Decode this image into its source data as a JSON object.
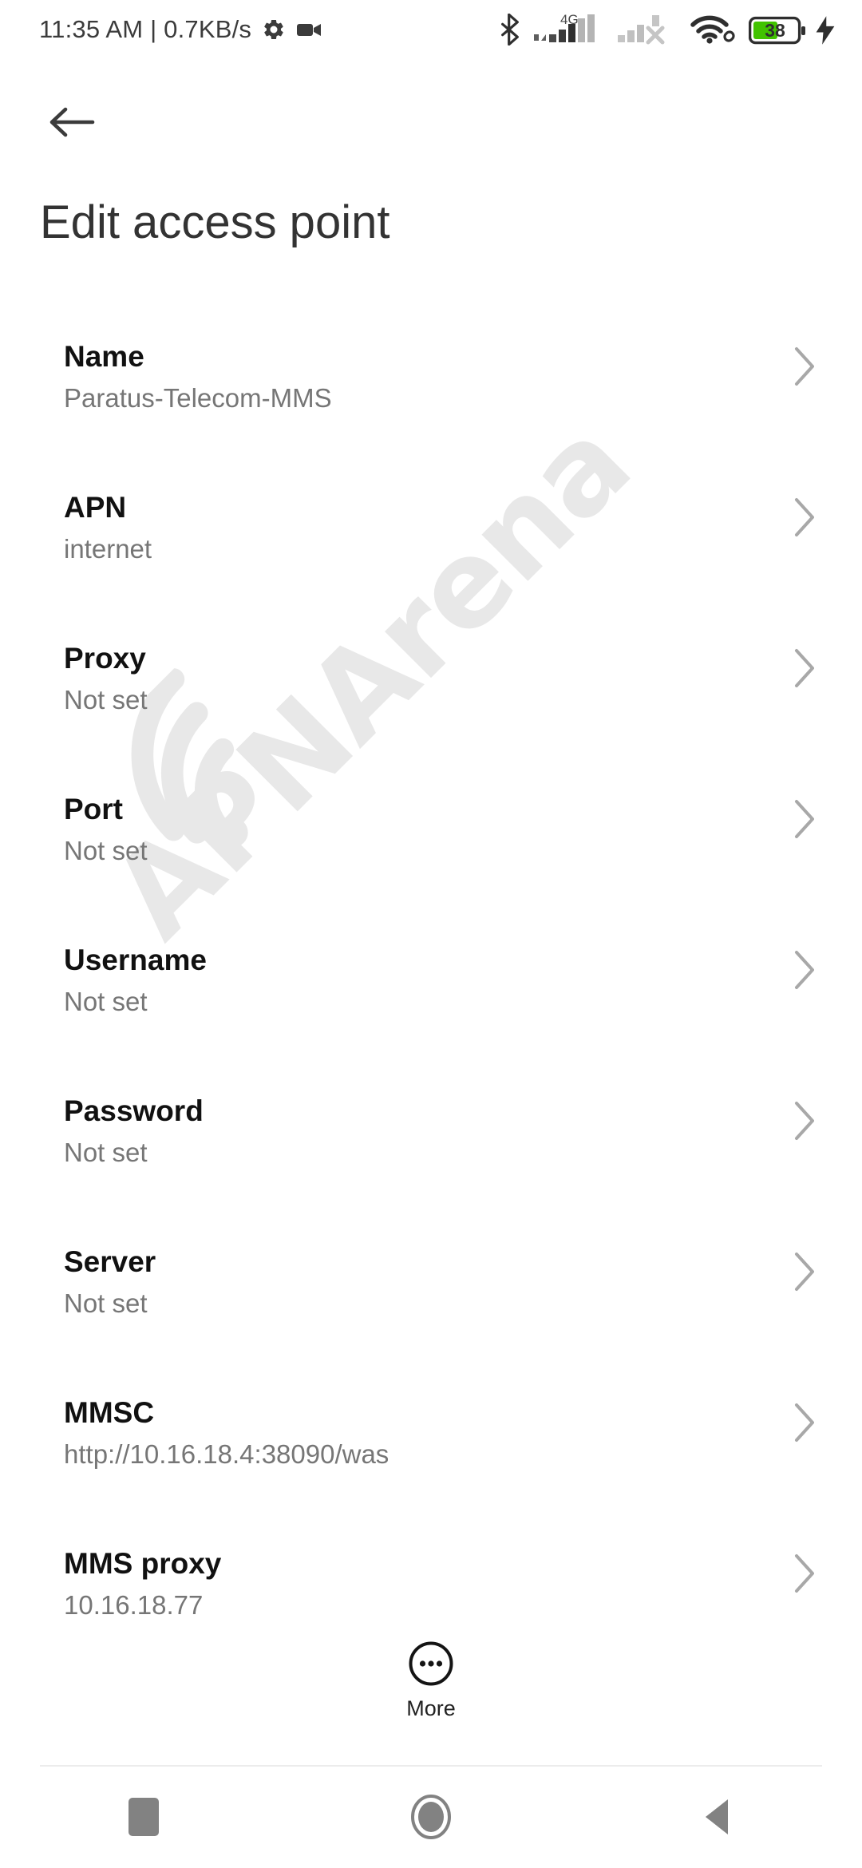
{
  "statusbar": {
    "clock": "11:35 AM | 0.7KB/s",
    "icons_left": [
      "gear-icon",
      "camcorder-icon"
    ],
    "bluetooth": "bluetooth-icon",
    "network_type": "4G",
    "sim1_signal": "signal-bars-icon",
    "sim2_signal": "signal-bars-off-icon",
    "wifi": "wifi-link-icon",
    "battery_percent": "38",
    "battery_charging": true,
    "battery_color": "#41c300"
  },
  "header": {
    "back_label": "back-arrow",
    "title": "Edit access point"
  },
  "list": {
    "rows": [
      {
        "title": "Name",
        "value": "Paratus-Telecom-MMS"
      },
      {
        "title": "APN",
        "value": "internet"
      },
      {
        "title": "Proxy",
        "value": "Not set"
      },
      {
        "title": "Port",
        "value": "Not set"
      },
      {
        "title": "Username",
        "value": "Not set"
      },
      {
        "title": "Password",
        "value": "Not set"
      },
      {
        "title": "Server",
        "value": "Not set"
      },
      {
        "title": "MMSC",
        "value": "http://10.16.18.4:38090/was"
      },
      {
        "title": "MMS proxy",
        "value": "10.16.18.77"
      }
    ]
  },
  "more": {
    "label": "More",
    "icon": "more-horizontal-circle-icon"
  },
  "navbar": {
    "recents": "recents-square-icon",
    "home": "home-circle-icon",
    "back": "back-triangle-icon"
  },
  "watermark": {
    "text": "APNArena",
    "icon": "wifi-arcs-icon",
    "color": "#e8e8e8"
  },
  "colors": {
    "background": "#ffffff",
    "title_text": "#333333",
    "row_title": "#111111",
    "row_value": "#767676",
    "chevron": "#a8a8a8",
    "nav_icon": "#828282",
    "divider": "#ececec"
  }
}
